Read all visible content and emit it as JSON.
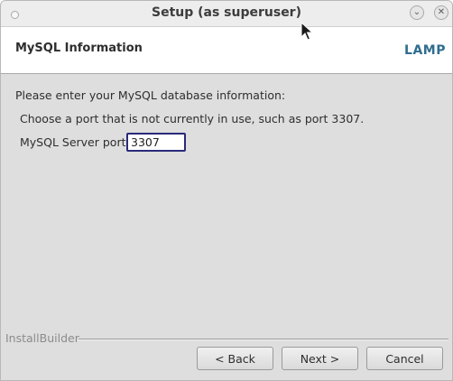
{
  "window": {
    "title": "Setup (as superuser)",
    "minimize_glyph": "⌄",
    "close_glyph": "✕"
  },
  "header": {
    "title": "MySQL Information",
    "logo": "LAMP"
  },
  "content": {
    "intro": "Please enter your MySQL database information:",
    "note": "Choose a port that is not currently in use, such as port 3307.",
    "port_label": "MySQL Server port",
    "port_value": "3307"
  },
  "footer": {
    "installer_label": "InstallBuilder",
    "back_label": "< Back",
    "next_label": "Next >",
    "cancel_label": "Cancel"
  },
  "colors": {
    "logo": "#2f6d8f",
    "input_border": "#2a2a7a"
  }
}
